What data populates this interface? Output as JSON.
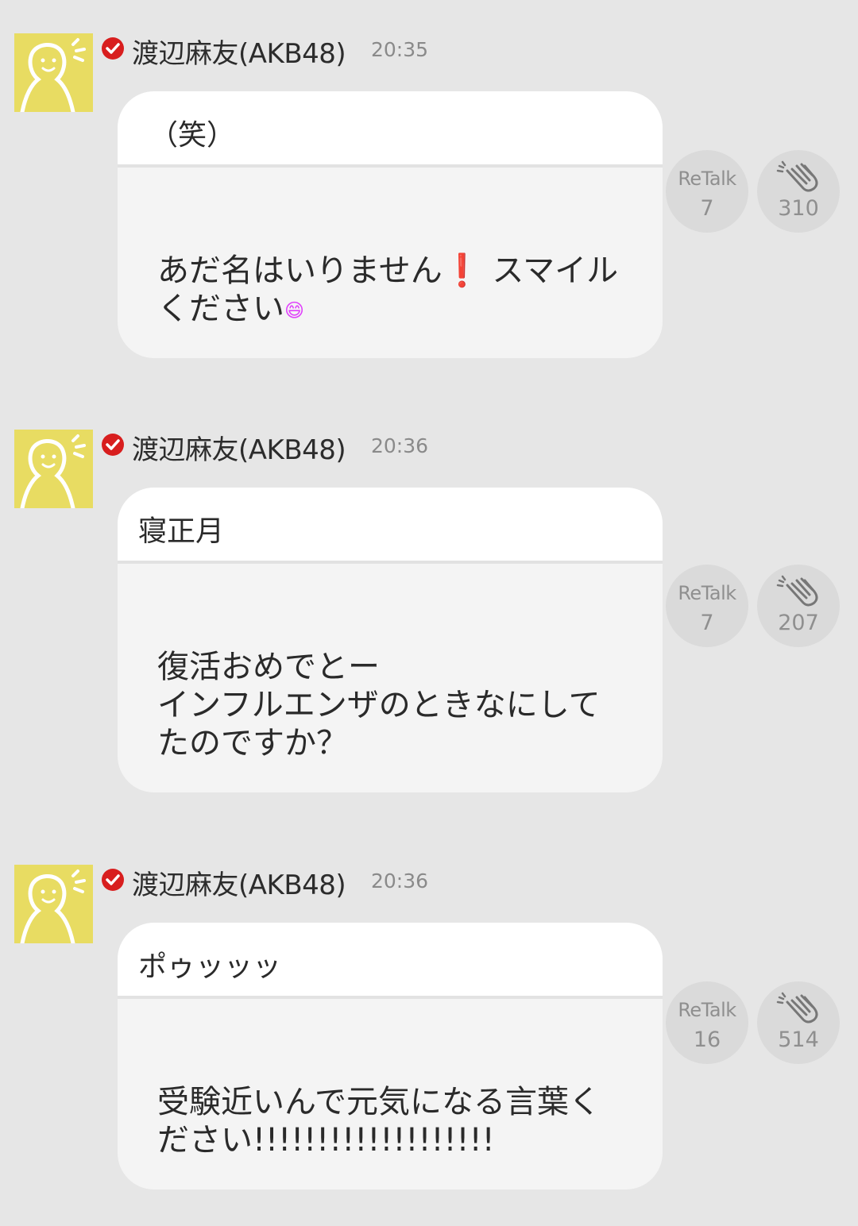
{
  "posts": [
    {
      "author": "渡辺麻友(AKB48)",
      "time": "20:35",
      "reply_text": "（笑）",
      "body_lines": [
        "あだ名はいりません",
        "❗",
        " スマイルください",
        "😄"
      ],
      "retalk_label": "ReTalk",
      "retalk_count": "7",
      "clap_count": "310"
    },
    {
      "author": "渡辺麻友(AKB48)",
      "time": "20:36",
      "reply_text": "寝正月",
      "body_text": "復活おめでとー\nインフルエンザのときなにしてたのですか？",
      "retalk_label": "ReTalk",
      "retalk_count": "7",
      "clap_count": "207"
    },
    {
      "author": "渡辺麻友(AKB48)",
      "time": "20:36",
      "reply_text": "ポゥッッッ",
      "body_text": "受験近いんで元気になる言葉ください!!!!!!!!!!!!!!!!!!!",
      "retalk_label": "ReTalk",
      "retalk_count": "16",
      "clap_count": "514"
    }
  ],
  "colors": {
    "background": "#e6e6e6",
    "avatar": "#e8dc62",
    "verified": "#d81e1e",
    "exclamation": "#e0161e",
    "emoji": "#e040fb"
  },
  "icons": {
    "avatar": "default-avatar-icon",
    "verified": "verified-check-icon",
    "clap": "clap-hands-icon"
  }
}
